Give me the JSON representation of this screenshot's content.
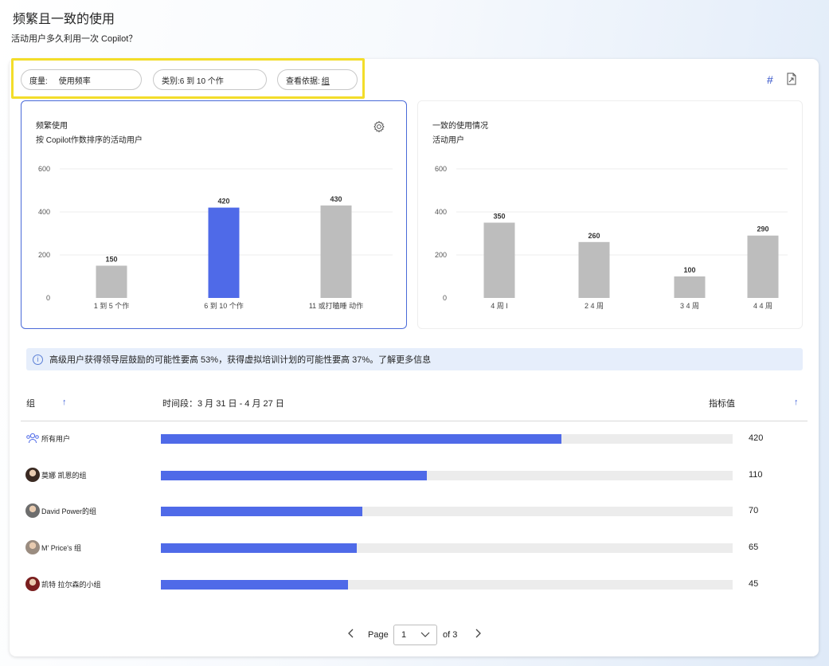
{
  "header": {
    "title": "频繁且一致的使用",
    "subtitle": "活动用户多久利用一次 Copilot？"
  },
  "filters": {
    "measure": {
      "label": "度量:",
      "value": "使用频率"
    },
    "category": {
      "label": "类别:",
      "value": "6 到 10 个作"
    },
    "view_by": {
      "label": "查看依据:",
      "value": "组"
    }
  },
  "toolbar": {
    "hash_icon": "hash-icon",
    "export_icon": "export-icon"
  },
  "charts": {
    "left": {
      "title": "频繁使用",
      "subtitle": "按 Copilot作数排序的活动用户",
      "settings_icon": "gear-icon"
    },
    "right": {
      "title": "一致的使用情况",
      "subtitle": "活动用户"
    }
  },
  "chart_data": [
    {
      "type": "bar",
      "title": "频繁使用",
      "subtitle": "按 Copilot作数排序的活动用户",
      "categories": [
        "1 到 5 个作",
        "6 到 10 个作",
        "11 或打瞌睡 动作"
      ],
      "values": [
        150,
        420,
        430
      ],
      "highlighted_index": 1,
      "ylim": [
        0,
        600
      ],
      "yticks": [
        0,
        200,
        400,
        600
      ],
      "grid": true,
      "colors": {
        "default": "#bdbdbd",
        "highlight": "#4f6ae8"
      }
    },
    {
      "type": "bar",
      "title": "一致的使用情况",
      "subtitle": "活动用户",
      "categories": [
        "4 周 I",
        "2 4 周",
        "3 4 周",
        "4 4 周"
      ],
      "values": [
        350,
        260,
        100,
        290
      ],
      "ylim": [
        0,
        600
      ],
      "yticks": [
        0,
        200,
        400,
        600
      ],
      "grid": true,
      "colors": {
        "default": "#bdbdbd"
      }
    }
  ],
  "banner": {
    "icon": "info-icon",
    "text": "高级用户获得领导层鼓励的可能性要高 53%，获得虚拟培训计划的可能性要高 37%。了解更多信息"
  },
  "table": {
    "group_header": "组",
    "period_header": "时间段：3 月 31 日 - 4 月 27 日",
    "metric_header": "指标值",
    "max": 600,
    "rows": [
      {
        "name": "所有用户",
        "value": 420,
        "fill_fraction": 0.7,
        "avatar": "group-icon"
      },
      {
        "name": "莫娜 凯恩的组",
        "value": 110,
        "fill_fraction": 0.465,
        "avatar": "avatar"
      },
      {
        "name": "David Power的组",
        "value": 70,
        "fill_fraction": 0.352,
        "avatar": "avatar"
      },
      {
        "name": "M' Price's 组",
        "value": 65,
        "fill_fraction": 0.343,
        "avatar": "avatar"
      },
      {
        "name": "凯特 拉尔森的小组",
        "value": 45,
        "fill_fraction": 0.327,
        "avatar": "avatar"
      }
    ]
  },
  "pagination": {
    "page_label": "Page",
    "current": "1",
    "of_label": "of 3"
  }
}
